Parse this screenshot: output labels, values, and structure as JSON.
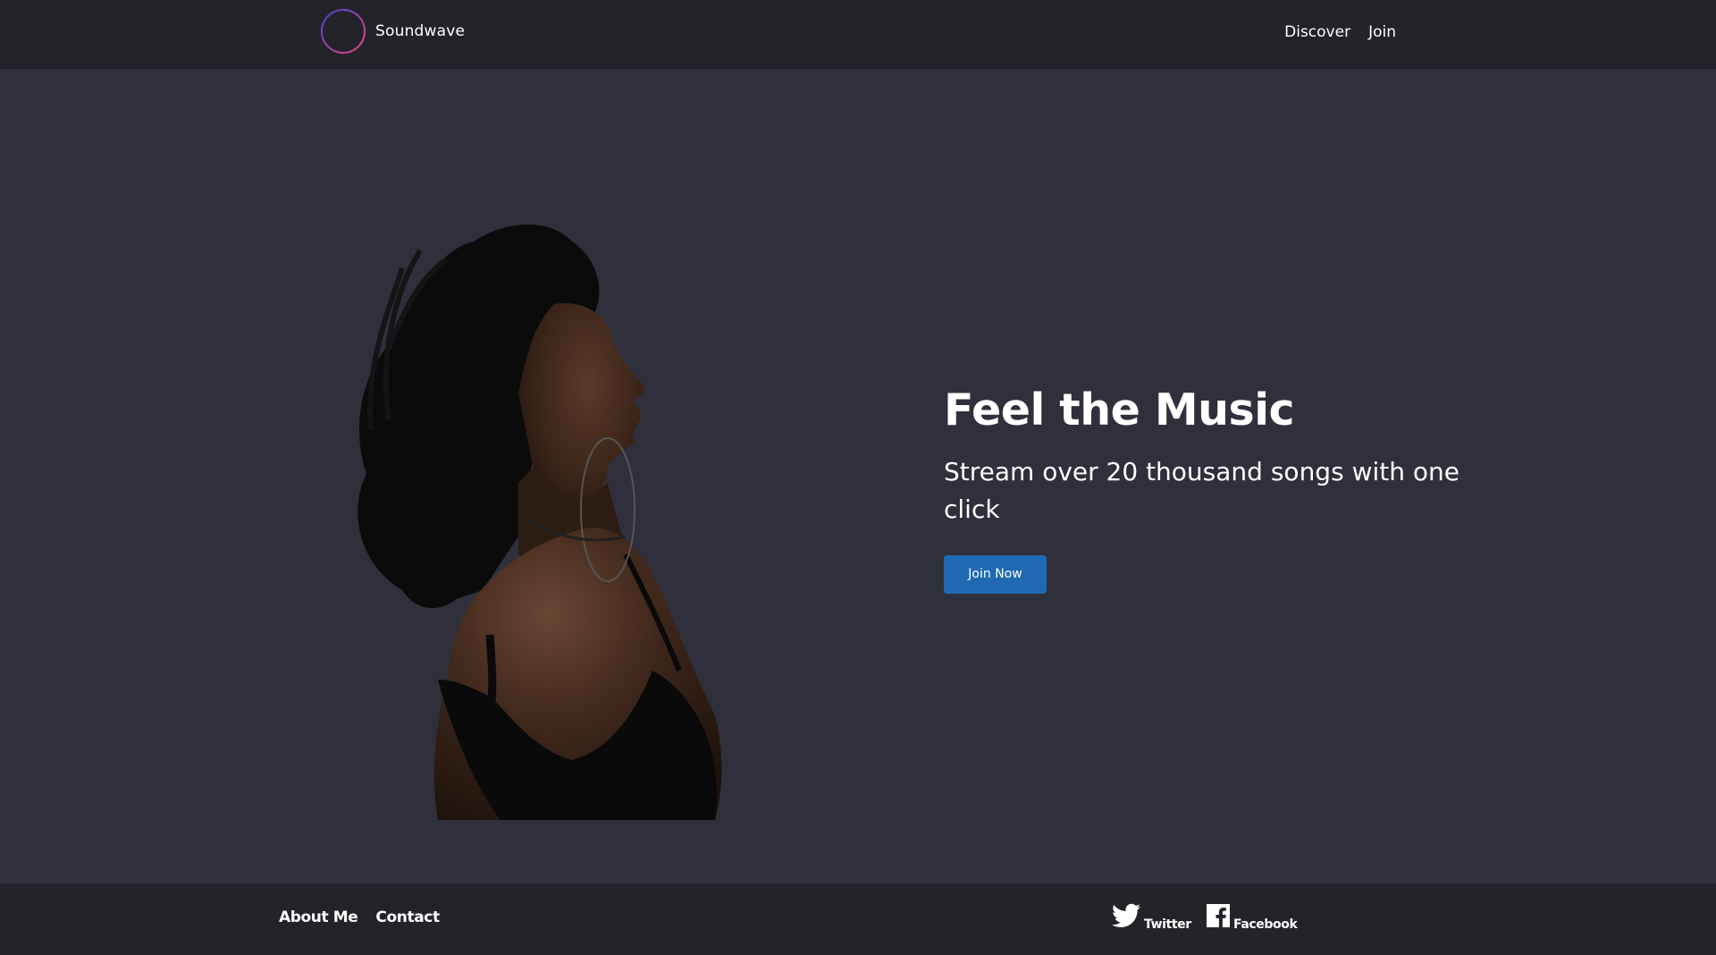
{
  "header": {
    "brand_name": "Soundwave",
    "nav": [
      {
        "label": "Discover"
      },
      {
        "label": "Join"
      }
    ]
  },
  "hero": {
    "title": "Feel the Music",
    "subtitle": "Stream over 20 thousand songs with one click",
    "cta_label": "Join Now"
  },
  "footer": {
    "links": [
      {
        "label": "About Me"
      },
      {
        "label": "Contact"
      }
    ],
    "social": [
      {
        "label": "Twitter",
        "icon": "twitter-icon"
      },
      {
        "label": "Facebook",
        "icon": "facebook-icon"
      }
    ]
  },
  "colors": {
    "header_bg": "#23232a",
    "page_bg": "#30303c",
    "cta_bg": "#1f6ab2",
    "logo_gradient_start": "#5b3fd6",
    "logo_gradient_end": "#e0427a"
  }
}
